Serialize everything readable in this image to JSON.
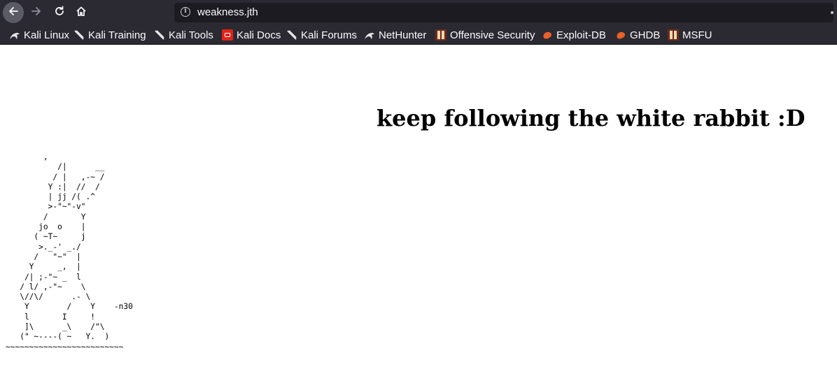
{
  "browser": {
    "url": "weakness.jth",
    "bookmarks": [
      {
        "label": "Kali Linux",
        "icon": "kali-dragon-icon"
      },
      {
        "label": "Kali Training",
        "icon": "kali-dragon-icon"
      },
      {
        "label": "Kali Tools",
        "icon": "kali-dragon-icon"
      },
      {
        "label": "Kali Docs",
        "icon": "kali-docs-icon"
      },
      {
        "label": "Kali Forums",
        "icon": "kali-dragon-icon"
      },
      {
        "label": "NetHunter",
        "icon": "kali-dragon-icon"
      },
      {
        "label": "Offensive Security",
        "icon": "offsec-icon"
      },
      {
        "label": "Exploit-DB",
        "icon": "exploitdb-flame-icon"
      },
      {
        "label": "GHDB",
        "icon": "exploitdb-flame-icon"
      },
      {
        "label": "MSFU",
        "icon": "offsec-icon"
      }
    ]
  },
  "page": {
    "heading": "keep following the white rabbit :D",
    "ascii_art": "        ,\n           /|      __\n          / |   ,-~ /\n         Y :|  //  /\n         | jj /( .^\n         >-\"~\"-v\"\n        /       Y\n       jo  o    |\n      ( ~T~     j\n       >._-' _./\n      /   \"~\"  |\n     Y     _,  |\n    /| ;-\"~ _  l\n   / l/ ,-\"~    \\\n   \\//\\/      .- \\\n    Y        /    Y    -n30\n    l       I     !\n    ]\\      _\\    /\"\\\n   (\" ~----( ~   Y.  )\n~~~~~~~~~~~~~~~~~~~~~~~~~"
  }
}
